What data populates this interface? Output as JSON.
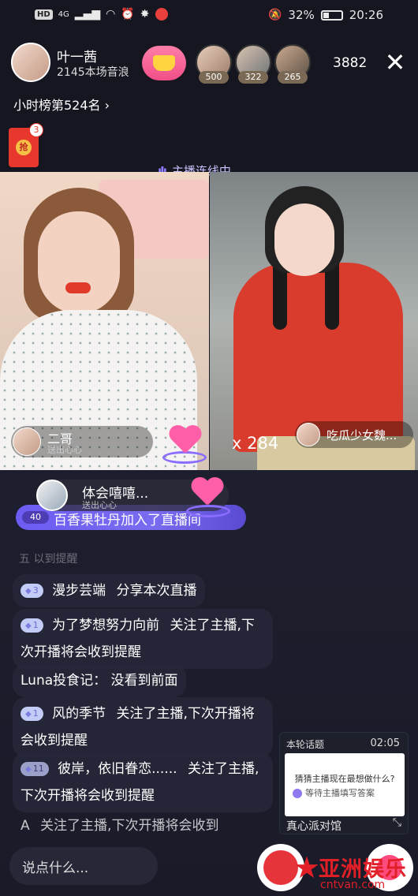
{
  "status_bar": {
    "left_chips": [
      "HD",
      "4G"
    ],
    "battery": "32%",
    "battery_level": 0.32,
    "time": "20:26"
  },
  "host": {
    "name": "叶一茜",
    "subtitle": "2145本场音浪"
  },
  "viewers": [
    {
      "badge": "500"
    },
    {
      "badge": "322"
    },
    {
      "badge": "265"
    }
  ],
  "viewer_count": "3882",
  "hourly_rank": "小时榜第524名",
  "red_packet": {
    "label": "抢",
    "count": "3"
  },
  "link_label": "主播连线中",
  "left_pane": {
    "caption_name": "二哥",
    "caption_sub": "送出心心"
  },
  "right_pane": {
    "combo": "x 284",
    "tag_name": "吃瓜少女魏..."
  },
  "gift_bar": {
    "title": "体会嘻嘻...",
    "sub": "送出心心"
  },
  "join_banner": {
    "level": "40",
    "text": "百香果牡丹加入了直播间"
  },
  "chat": {
    "faded_top": "五 以到提醒",
    "messages": [
      {
        "level": "3",
        "user": "漫步芸端",
        "text": "分享本次直播"
      },
      {
        "level": "1",
        "user": "为了梦想努力向前",
        "text": "关注了主播,下次开播将会收到提醒"
      },
      {
        "level": "",
        "user": "Luna投食记：",
        "text": "没看到前面"
      },
      {
        "level": "1",
        "user": "风的季节",
        "text": "关注了主播,下次开播将会收到提醒"
      },
      {
        "level": "11",
        "user": "彼岸，依旧眷恋......",
        "text": "关注了主播,下次开播将会收到提醒"
      },
      {
        "level": "",
        "user": "A",
        "text": "关注了主播,下次开播将会收到"
      }
    ]
  },
  "topic": {
    "header": "本轮话题",
    "time": "02:05",
    "question": "猜猜主播现在最想做什么?",
    "answer": "等待主播填写答案",
    "footer": "真心派对馆"
  },
  "input_placeholder": "说点什么...",
  "watermark": {
    "cn": "亚洲娱乐",
    "en": "cntvan.com"
  }
}
